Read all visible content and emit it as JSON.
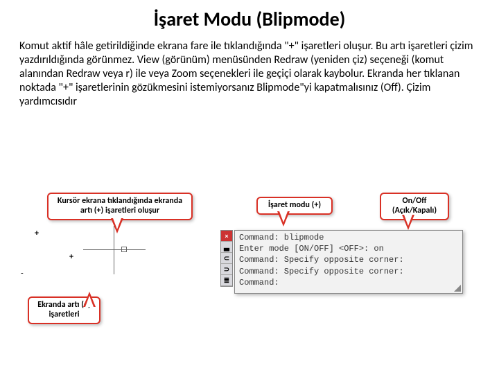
{
  "title": "İşaret Modu (Blipmode)",
  "paragraph": "Komut aktif hâle getirildiğinde ekrana fare ile tıklandığında \"+\" işaretleri oluşur. Bu artı işaretleri çizim yazdırıldığında görünmez. View (görünüm) menüsünden Redraw (yeniden çiz) seçeneği (komut alanından Redraw veya r) ile veya Zoom seçenekleri ile geçiçi olarak kaybolur. Ekranda her tıklanan noktada \"+\" işaretlerinin gözükmesini istemiyorsanız Blipmode\"yi kapatmalısınız (Off). Çizim yardımcısıdır",
  "callouts": {
    "cursor": "Kursör ekrana tıklandığında ekranda artı (+) işaretleri oluşur",
    "mode": "İşaret modu (+)",
    "onoff": "On/Off (Açık/Kapalı)",
    "plus": "Ekranda artı (+) işaretleri"
  },
  "command_lines": [
    "Command: blipmode",
    "Enter mode [ON/OFF] <OFF>: on",
    "Command: Specify opposite corner:",
    "Command: Specify opposite corner:",
    "Command:"
  ],
  "marks": {
    "plus": "+",
    "dash": "-"
  },
  "toolbar_icons": [
    "×",
    "▃",
    "⊂",
    "⊃",
    "≣"
  ]
}
